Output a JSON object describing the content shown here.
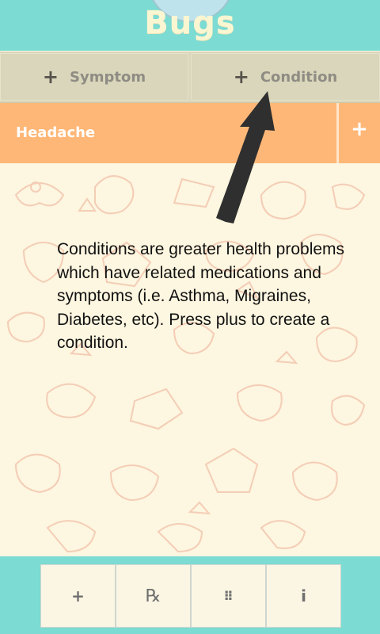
{
  "header": {
    "title": "Bugs",
    "accent_color": "#7cdbd3"
  },
  "add_bar": {
    "symptom_label": "Symptom",
    "condition_label": "Condition",
    "plus_icon": "plus-icon"
  },
  "condition_row": {
    "name": "Headache",
    "color": "#ffb777"
  },
  "hint": {
    "text": "Conditions are greater health problems which have related medications and symptoms (i.e. Asthma, Migraines, Diabetes, etc). Press plus to create a condition."
  },
  "bottom_nav": {
    "items": [
      {
        "icon": "plus-icon",
        "glyph": "+"
      },
      {
        "icon": "prescription-icon",
        "glyph": "℞"
      },
      {
        "icon": "grid-icon",
        "glyph": "⠿"
      },
      {
        "icon": "info-icon",
        "glyph": "i"
      }
    ]
  }
}
